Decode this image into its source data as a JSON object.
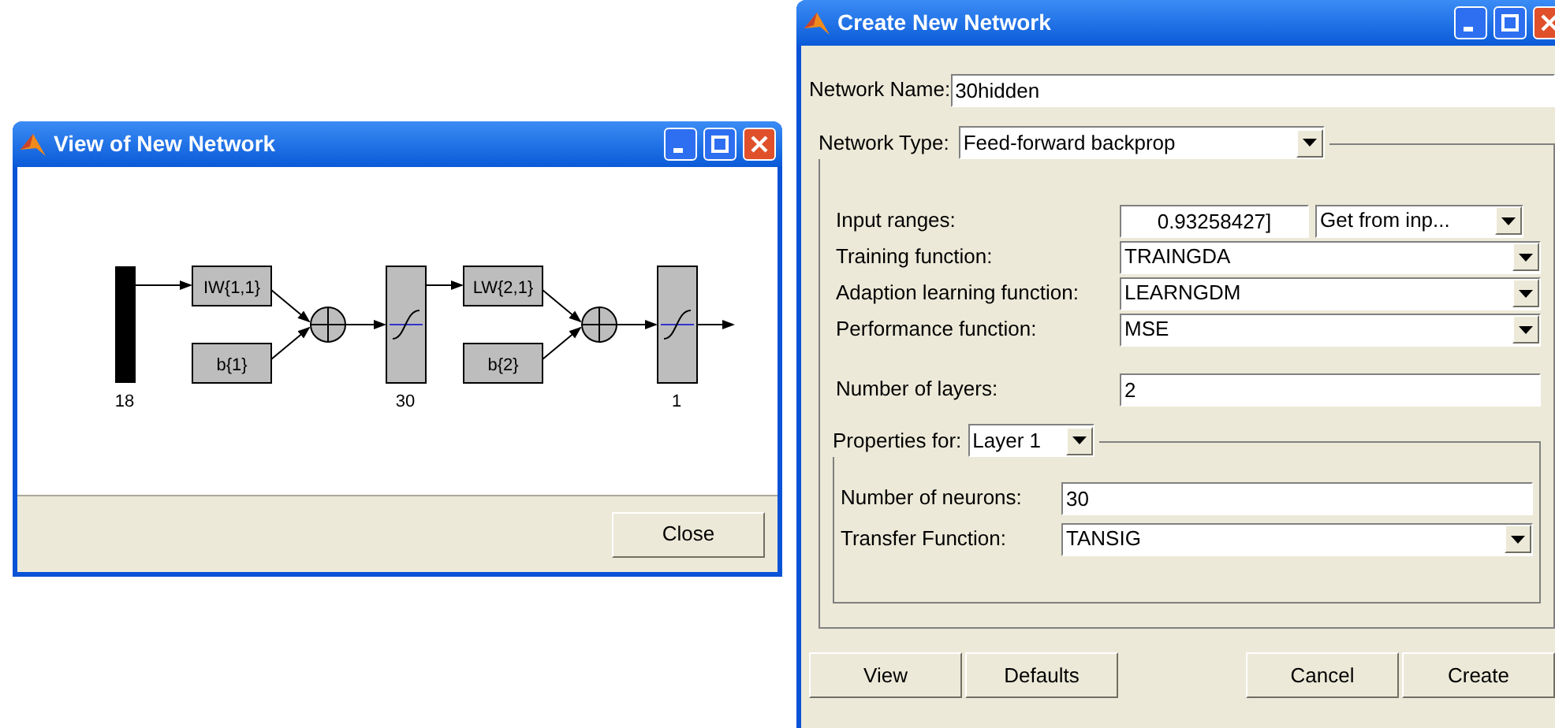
{
  "view_window": {
    "title": "View of New Network",
    "diagram": {
      "input_size": "18",
      "layers": [
        {
          "weight": "IW{1,1}",
          "bias": "b{1}",
          "size": "30"
        },
        {
          "weight": "LW{2,1}",
          "bias": "b{2}",
          "size": "1"
        }
      ]
    },
    "buttons": [
      "Close"
    ]
  },
  "create_window": {
    "title": "Create New Network",
    "network_name": {
      "label": "Network Name:",
      "value": "30hidden"
    },
    "network_type": {
      "label": "Network Type:",
      "value": "Feed-forward backprop"
    },
    "fields": [
      {
        "kind": "split",
        "label": "Input ranges:",
        "value": "0.93258427]",
        "option": "Get from inp..."
      },
      {
        "kind": "dropdown",
        "label": "Training function:",
        "value": "TRAINGDA"
      },
      {
        "kind": "dropdown",
        "label": "Adaption learning function:",
        "value": "LEARNGDM"
      },
      {
        "kind": "dropdown",
        "label": "Performance function:",
        "value": "MSE"
      },
      {
        "kind": "text",
        "label": "Number of layers:",
        "value": "2"
      }
    ],
    "properties": {
      "label": "Properties for:",
      "value": "Layer 1",
      "fields": [
        {
          "kind": "text",
          "label": "Number of neurons:",
          "value": "30"
        },
        {
          "kind": "dropdown",
          "label": "Transfer Function:",
          "value": "TANSIG"
        }
      ]
    },
    "buttons": [
      "View",
      "Defaults",
      "Cancel",
      "Create"
    ]
  }
}
